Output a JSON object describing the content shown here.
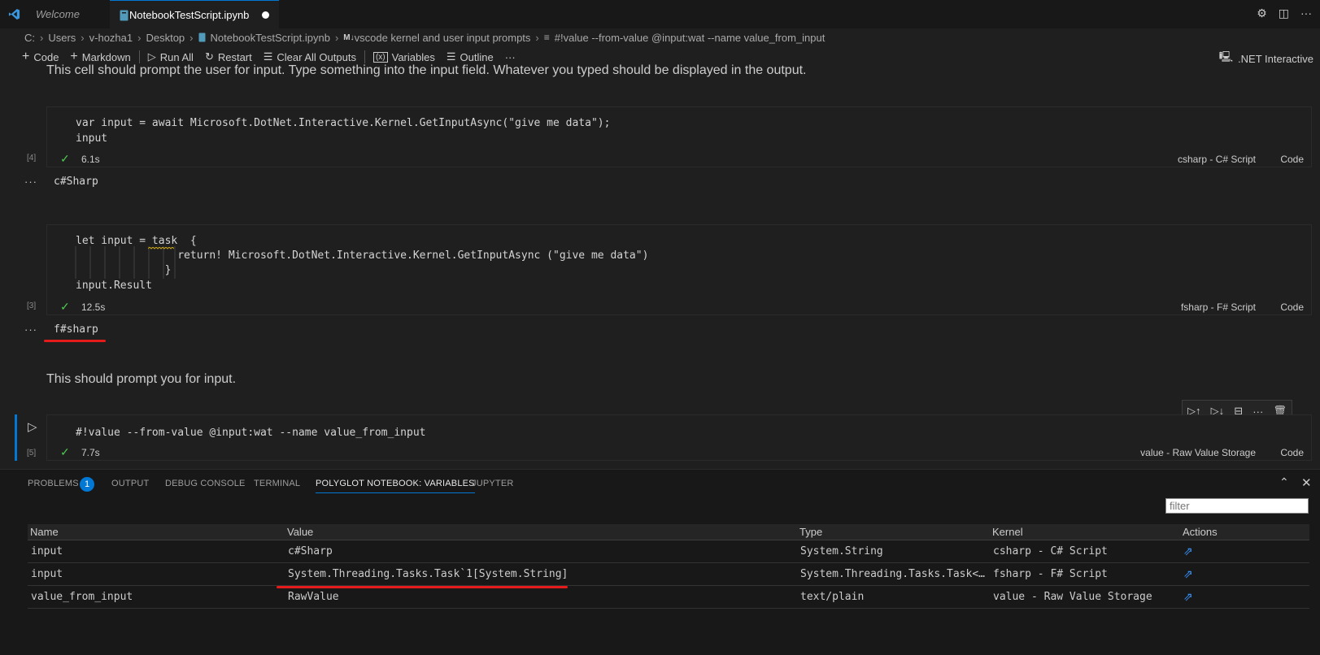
{
  "tabs": [
    {
      "label": "Welcome"
    },
    {
      "label": "NotebookTestScript.ipynb"
    }
  ],
  "breadcrumb": [
    "C:",
    "Users",
    "v-hozha1",
    "Desktop",
    "NotebookTestScript.ipynb",
    "vscode kernel and user input prompts",
    "#!value --from-value @input:wat --name value_from_input"
  ],
  "toolbar": {
    "code": "Code",
    "markdown": "Markdown",
    "run_all": "Run All",
    "restart": "Restart",
    "clear": "Clear All Outputs",
    "variables": "Variables",
    "outline": "Outline",
    "more": "···",
    "kernel": ".NET Interactive"
  },
  "cells": {
    "md1": "This cell should prompt the user for input. Type something into the input field. Whatever you typed should be displayed in the output.",
    "c1": {
      "lines": [
        "var input = await Microsoft.DotNet.Interactive.Kernel.GetInputAsync(\"give me data\");",
        "input"
      ],
      "exec": "[4]",
      "time": "6.1s",
      "lang": "csharp - C# Script",
      "code_label": "Code",
      "output": "c#Sharp"
    },
    "c2": {
      "lines": [
        "let input = task  {",
        "                return! Microsoft.DotNet.Interactive.Kernel.GetInputAsync (\"give me data\")",
        "              }",
        "input.Result"
      ],
      "exec": "[3]",
      "time": "12.5s",
      "lang": "fsharp - F# Script",
      "code_label": "Code",
      "output": "f#sharp"
    },
    "md2": "This should prompt you for input.",
    "c3": {
      "lines": [
        "#!value --from-value @input:wat --name value_from_input"
      ],
      "exec": "[5]",
      "time": "7.7s",
      "lang": "value - Raw Value Storage",
      "code_label": "Code"
    },
    "ellipsis": "···"
  },
  "panel": {
    "tabs": [
      "PROBLEMS",
      "OUTPUT",
      "DEBUG CONSOLE",
      "TERMINAL",
      "POLYGLOT NOTEBOOK: VARIABLES",
      "JUPYTER"
    ],
    "problems_count": "1",
    "filter_placeholder": "filter",
    "columns": [
      "Name",
      "Value",
      "Type",
      "Kernel",
      "Actions"
    ],
    "rows": [
      {
        "name": "input",
        "value": "c#Sharp",
        "type": "System.String",
        "kernel": "csharp - C# Script"
      },
      {
        "name": "input",
        "value": "System.Threading.Tasks.Task`1[System.String]",
        "type": "System.Threading.Tasks.Task<...",
        "kernel": "fsharp - F# Script"
      },
      {
        "name": "value_from_input",
        "value": "RawValue",
        "type": "text/plain",
        "kernel": "value - Raw Value Storage"
      }
    ]
  },
  "colors": {
    "accent": "#0078d4",
    "annotation": "#e51b1b",
    "success": "#4ec94e"
  }
}
